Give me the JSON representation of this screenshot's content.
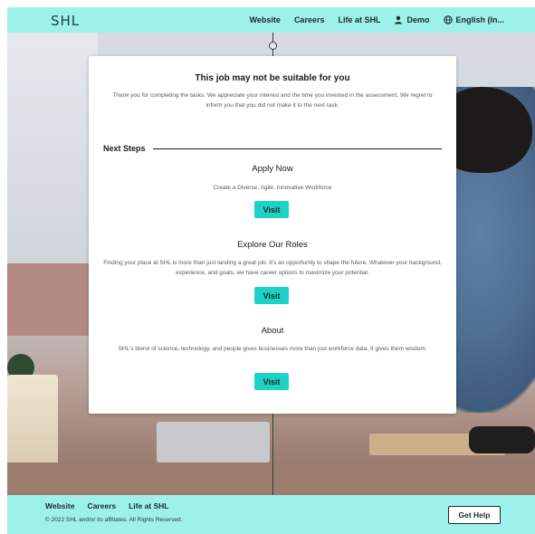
{
  "header": {
    "logo": "SHL",
    "nav": [
      {
        "label": "Website"
      },
      {
        "label": "Careers"
      },
      {
        "label": "Life at SHL"
      },
      {
        "label": "Demo",
        "icon": "user-icon"
      },
      {
        "label": "English (In...",
        "icon": "globe-icon"
      }
    ]
  },
  "card": {
    "title": "This job may not be suitable for you",
    "message": "Thank you for completing the tasks. We appreciate your interest and the time you invested in the assessment. We regret to inform you that you did not make it to the next task.",
    "next_steps_label": "Next Steps",
    "sections": [
      {
        "title": "Apply Now",
        "text": "Create a Diverse, Agile, Innovative Workforce",
        "button": "Visit"
      },
      {
        "title": "Explore Our Roles",
        "text": "Finding your place at SHL is more than just landing a great job. It's an opportunity to shape the future. Whatever your background, experience, and goals, we have career options to maximize your potential.",
        "button": "Visit"
      },
      {
        "title": "About",
        "text": "SHL's blend of science, technology, and people gives businesses more than just workforce data. It gives them wisdom.",
        "button": "Visit"
      }
    ]
  },
  "footer": {
    "links": [
      {
        "label": "Website"
      },
      {
        "label": "Careers"
      },
      {
        "label": "Life at SHL"
      }
    ],
    "copyright": "© 2022 SHL and/or its affiliates. All Rights Reserved.",
    "help_button": "Get Help"
  },
  "colors": {
    "accent": "#1fd1c6",
    "bar": "#9ef0ea"
  }
}
